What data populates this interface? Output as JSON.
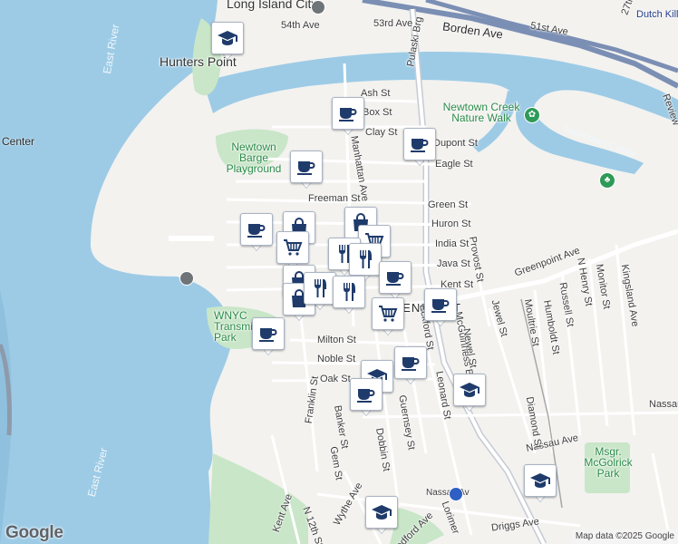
{
  "attribution": "Map data ©2025 Google",
  "logo": "Google",
  "water_labels": [
    {
      "id": "east-river-north",
      "text": "East River"
    },
    {
      "id": "east-river-south",
      "text": "East River"
    }
  ],
  "place_labels": [
    {
      "id": "long-island-city",
      "text": "Long Island City"
    },
    {
      "id": "hunters-point",
      "text": "Hunters Point"
    },
    {
      "id": "newtown-creek-nature-walk",
      "text": "Newtown Creek Nature Walk"
    },
    {
      "id": "newtown-creek",
      "text": "Newtown Creek"
    },
    {
      "id": "newtown-barge-playground",
      "text": "Newtown Barge Playground"
    },
    {
      "id": "wnyc-transmitter-park",
      "text": "WNYC Transmitter Park"
    },
    {
      "id": "greenpoint",
      "text": "GREENPOINT"
    },
    {
      "id": "msgr-mcgolrick-park",
      "text": "Msgr. McGolrick Park"
    },
    {
      "id": "dutch-kills",
      "text": "Dutch Kills"
    },
    {
      "id": "center",
      "text": "Center"
    },
    {
      "id": "nassau-av-station",
      "text": "Nassau Av"
    }
  ],
  "street_labels": [
    "54th Ave",
    "53rd Ave",
    "Borden Ave",
    "51st Ave",
    "Pulaski Brg",
    "27th",
    "Review",
    "Ash St",
    "Box St",
    "Clay St",
    "Dupont St",
    "Eagle St",
    "Freeman St",
    "Green St",
    "Huron St",
    "India St",
    "Java St",
    "Kent St",
    "Greenpoint Ave",
    "Provost St",
    "N Henry St",
    "Monitor St",
    "Kingsland Ave",
    "Jewel St",
    "Moultrie St",
    "Russell St",
    "Humboldt St",
    "Manhattan Ave",
    "Eckford St",
    "McGuinness Blvd",
    "Newel St",
    "Milton St",
    "Noble St",
    "Oak St",
    "Franklin St",
    "Banker St",
    "Gem St",
    "Dobbin St",
    "Guernsey St",
    "Leonard St",
    "Lorimer",
    "Nassau Ave",
    "Diamond St",
    "Wythe Ave",
    "Kent Ave",
    "N 12th St",
    "Driggs Ave",
    "Bedford Ave",
    "Nassau"
  ],
  "markers": [
    {
      "id": "school-hunters-point",
      "type": "school"
    },
    {
      "id": "cafe-box-st",
      "type": "cafe"
    },
    {
      "id": "cafe-dupont",
      "type": "cafe"
    },
    {
      "id": "cafe-eagle",
      "type": "cafe"
    },
    {
      "id": "cafe-west-pier",
      "type": "cafe"
    },
    {
      "id": "shop-huron",
      "type": "shopping"
    },
    {
      "id": "shop-huron-2",
      "type": "shopping"
    },
    {
      "id": "grocery-india",
      "type": "grocery"
    },
    {
      "id": "grocery-india-2",
      "type": "grocery"
    },
    {
      "id": "food-java",
      "type": "restaurant"
    },
    {
      "id": "food-java-2",
      "type": "restaurant"
    },
    {
      "id": "cafe-java",
      "type": "cafe"
    },
    {
      "id": "shop-java",
      "type": "shopping"
    },
    {
      "id": "shop-kent",
      "type": "shopping"
    },
    {
      "id": "food-kent",
      "type": "restaurant"
    },
    {
      "id": "food-kent-2",
      "type": "restaurant"
    },
    {
      "id": "grocery-greenpoint-ave",
      "type": "grocery"
    },
    {
      "id": "cafe-greenpoint-east",
      "type": "cafe"
    },
    {
      "id": "cafe-transmitter-park",
      "type": "cafe"
    },
    {
      "id": "cafe-noble",
      "type": "cafe"
    },
    {
      "id": "school-oak",
      "type": "school"
    },
    {
      "id": "cafe-oak",
      "type": "cafe"
    },
    {
      "id": "school-mcguinness",
      "type": "school"
    },
    {
      "id": "school-mcgolrick",
      "type": "school"
    },
    {
      "id": "school-nassau-ave",
      "type": "school"
    }
  ]
}
